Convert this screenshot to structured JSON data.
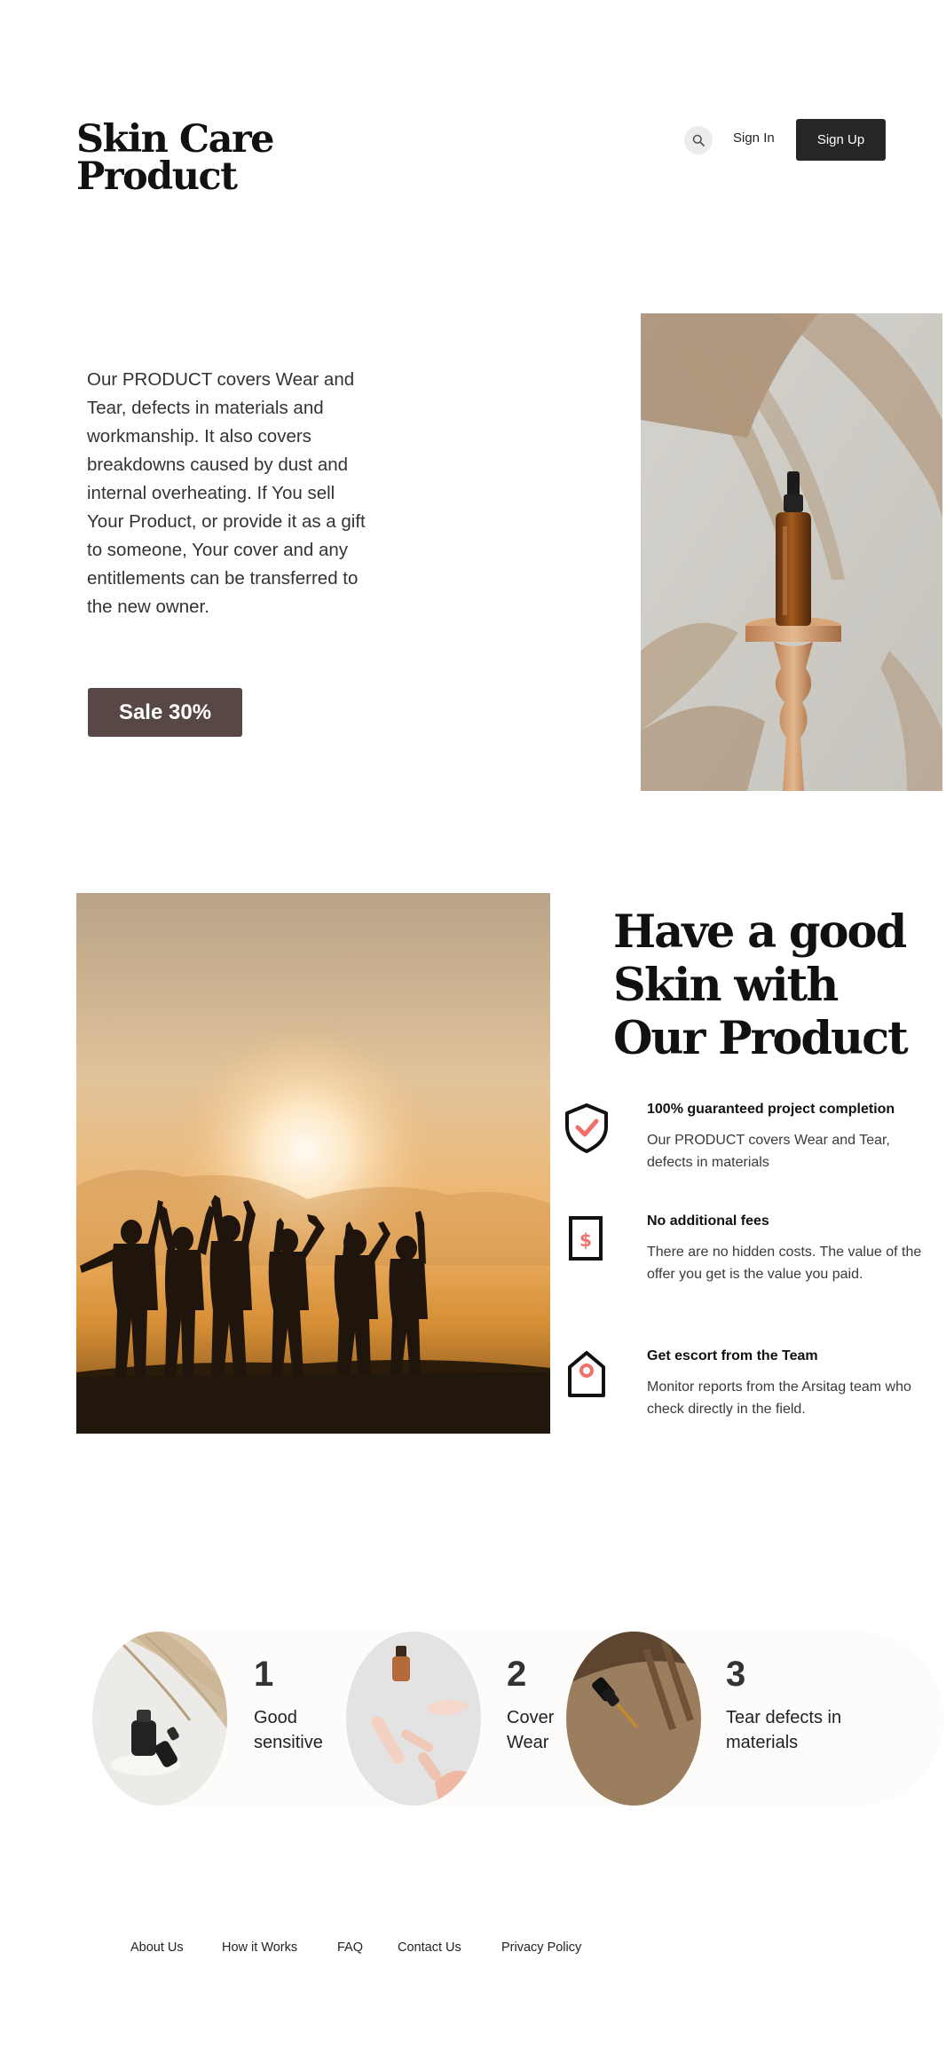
{
  "header": {
    "brand": "Skin Care Product",
    "search_icon": "search-icon",
    "signin_label": "Sign In",
    "signup_label": "Sign Up"
  },
  "hero": {
    "paragraph": "Our PRODUCT covers Wear and Tear, defects in materials and workmanship. It also covers breakdowns caused by dust and internal overheating. If You sell Your Product, or provide it as a gift to someone, Your cover and any entitlements can be transferred to the new owner.",
    "sale_label": "Sale 30%",
    "image": "serum-bottle-on-wooden-stand-photo"
  },
  "benefits": {
    "title": "Have a good Skin with Our Product",
    "image": "group-silhouette-sunset-photo",
    "features": [
      {
        "icon": "shield-check-icon",
        "title": "100% guaranteed project completion",
        "desc": "Our PRODUCT covers Wear and Tear, defects in materials"
      },
      {
        "icon": "dollar-document-icon",
        "title": "No additional fees",
        "desc": "There are no hidden costs. The value of the offer you get is the value you paid."
      },
      {
        "icon": "tag-icon",
        "title": "Get escort from the Team",
        "desc": "Monitor reports from the Arsitag team who check directly in the field."
      }
    ]
  },
  "steps": [
    {
      "number": "1",
      "label": "Good sensitive",
      "image": "dropper-bottles-photo"
    },
    {
      "number": "2",
      "label": "Cover Wear",
      "image": "face-roller-photo"
    },
    {
      "number": "3",
      "label": "Tear defects in materials",
      "image": "dropper-shadow-photo"
    }
  ],
  "footer": {
    "links": [
      "About Us",
      "How it Works",
      "FAQ",
      "Contact Us",
      "Privacy Policy"
    ]
  },
  "colors": {
    "dark_button": "#262626",
    "sale_button": "#574846",
    "icon_accent": "#f0706a"
  }
}
